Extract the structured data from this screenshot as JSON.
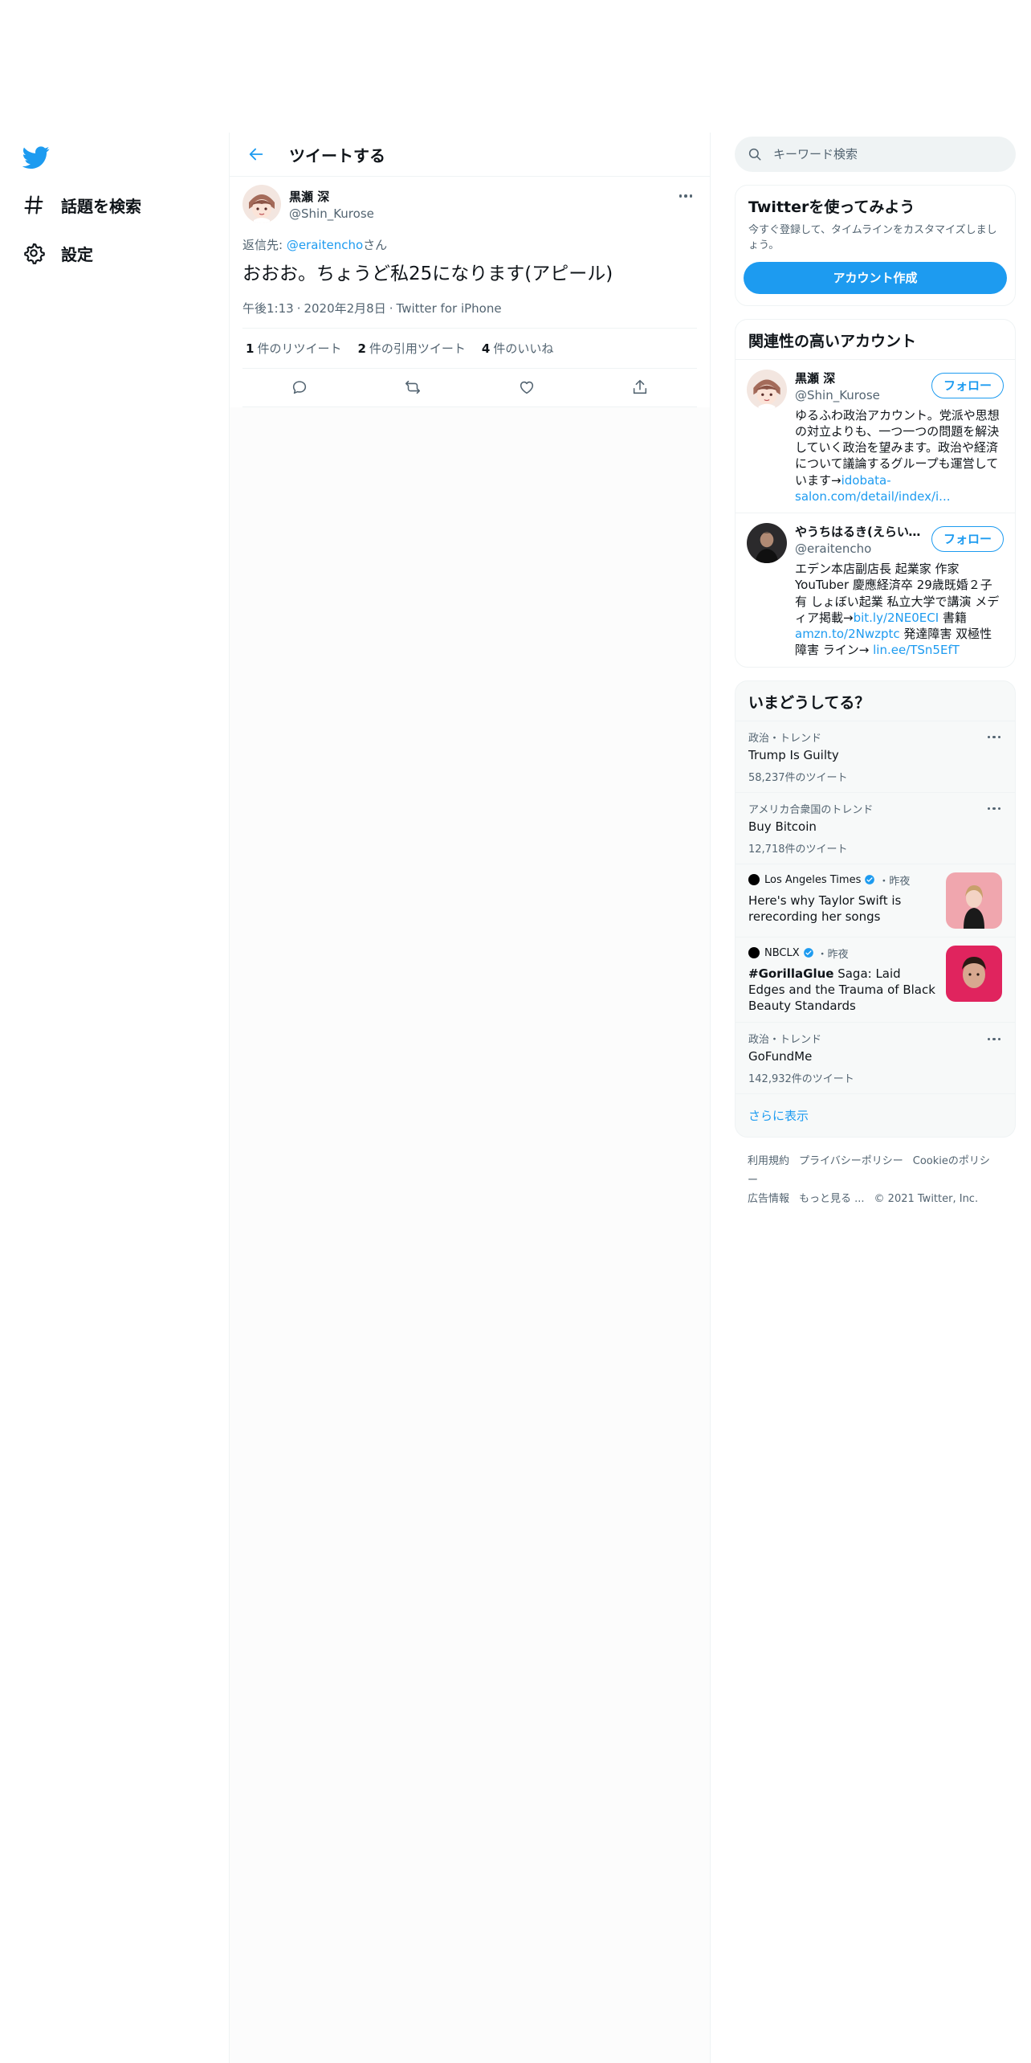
{
  "nav": {
    "explore_label": "話題を検索",
    "settings_label": "設定"
  },
  "header": {
    "title": "ツイートする"
  },
  "tweet": {
    "author_name": "黒瀬 深",
    "author_handle": "@Shin_Kurose",
    "reply_prefix": "返信先: ",
    "reply_handle": "@eraitencho",
    "reply_suffix": "さん",
    "text": "おおお。ちょうど私25になります(アピール)",
    "time": "午後1:13",
    "date": "2020年2月8日",
    "source": "Twitter for iPhone",
    "retweets": {
      "count": "1",
      "label": "件のリツイート"
    },
    "quotes": {
      "count": "2",
      "label": "件の引用ツイート"
    },
    "likes": {
      "count": "4",
      "label": "件のいいね"
    }
  },
  "search": {
    "placeholder": "キーワード検索"
  },
  "signup": {
    "title": "Twitterを使ってみよう",
    "description": "今すぐ登録して、タイムラインをカスタマイズしましょう。",
    "button": "アカウント作成"
  },
  "related": {
    "title": "関連性の高いアカウント",
    "accounts": [
      {
        "name": "黒瀬 深",
        "handle": "@Shin_Kurose",
        "follow": "フォロー",
        "bio_text": "ゆるふわ政治アカウント。党派や思想の対立よりも、一つ一つの問題を解決していく政治を望みます。政治や経済について議論するグループも運営しています→",
        "bio_link": "idobata-salon.com/detail/index/i..."
      },
      {
        "name": "やうちはるき(えらいてんちょう)",
        "handle": "@eraitencho",
        "follow": "フォロー",
        "bio_text1": "エデン本店副店長 起業家 作家 YouTuber 慶應経済卒 29歳既婚２子有 しょぼい起業 私立大学で講演 メディア掲載→",
        "bio_link1": "bit.ly/2NE0ECI",
        "bio_text2": " 書籍",
        "bio_link2": "amzn.to/2Nwzptc",
        "bio_text3": " 発達障害 双極性障害 ライン→ ",
        "bio_link3": "lin.ee/TSn5EfT"
      }
    ]
  },
  "trends": {
    "title": "いまどうしてる？",
    "items": [
      {
        "context": "政治・トレンド",
        "name": "Trump Is Guilty",
        "count": "58,237件のツイート"
      },
      {
        "context": "アメリカ合衆国のトレンド",
        "name": "Buy Bitcoin",
        "count": "12,718件のツイート"
      },
      {
        "context": "政治・トレンド",
        "name": "GoFundMe",
        "count": "142,932件のツイート"
      }
    ],
    "news": [
      {
        "source": "Los Angeles Times",
        "time": "・昨夜",
        "title": "Here's why Taylor Swift is rerecording her songs"
      },
      {
        "source": "NBCLX",
        "time": "・昨夜",
        "title_bold": "#GorillaGlue",
        "title_rest": " Saga: Laid Edges and the Trauma of Black Beauty Standards"
      }
    ],
    "show_more": "さらに表示"
  },
  "footer": {
    "terms": "利用規約",
    "privacy": "プライバシーポリシー",
    "cookies": "Cookieのポリシー",
    "ads": "広告情報",
    "more": "もっと見る ...",
    "copyright": "© 2021 Twitter, Inc."
  },
  "colors": {
    "accent": "#1d9bf0",
    "text": "#0f1419",
    "muted": "#536471"
  }
}
